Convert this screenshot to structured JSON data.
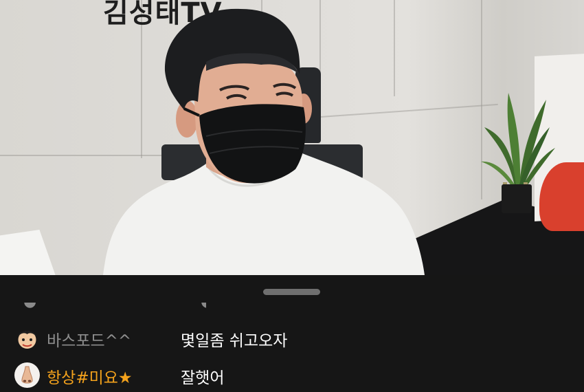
{
  "video": {
    "wall_logo_text": "김성태TV"
  },
  "chat": {
    "messages": [
      {
        "nickname": "바스포드^^",
        "text": "몇일좀 쉬고오자",
        "nick_color": "#8e8e8e",
        "avatar_icon": "cartoon-face-avatar-icon"
      },
      {
        "nickname": "항상#미요★",
        "text": "잘햇어",
        "nick_color": "#f4a21c",
        "avatar_icon": "cartoon-nose-avatar-icon"
      }
    ]
  },
  "colors": {
    "chat_background": "#161616",
    "message_text": "#ffffff",
    "handle": "#6f6f6f"
  }
}
